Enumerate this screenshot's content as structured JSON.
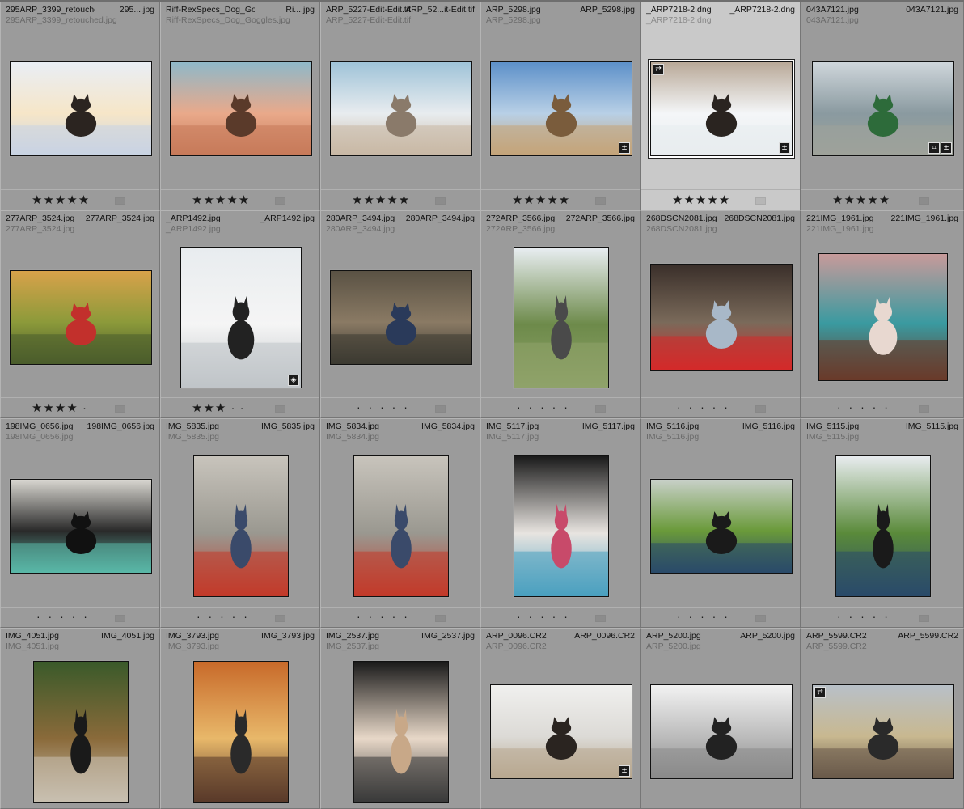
{
  "app": {
    "view": "Library Grid"
  },
  "rating_symbols": {
    "star": "★",
    "dot": "·"
  },
  "cells": [
    {
      "name_left": "295ARP_3399_retouched.jpg",
      "name_right": "295....jpg",
      "name_sub": "295ARP_3399_retouched.jpg",
      "rating": 5,
      "photo": "dog-snow-bokeh",
      "orientation": "landscape",
      "badges": []
    },
    {
      "name_left": "Riff-RexSpecs_Dog_Goggles.jpg",
      "name_right": "Ri....jpg",
      "name_sub": "Riff-RexSpecs_Dog_Goggles.jpg",
      "rating": 5,
      "photo": "dog-sunset-rock",
      "orientation": "landscape",
      "badges": []
    },
    {
      "name_left": "ARP_5227-Edit-Edit.tif",
      "name_right": "ARP_52...it-Edit.tif",
      "name_sub": "ARP_5227-Edit-Edit.tif",
      "rating": 5,
      "photo": "dog-desert",
      "orientation": "landscape",
      "badges": []
    },
    {
      "name_left": "ARP_5298.jpg",
      "name_right": "ARP_5298.jpg",
      "name_sub": "ARP_5298.jpg",
      "rating": 5,
      "photo": "woman-desert",
      "orientation": "landscape",
      "badges": [
        "develop-adjusted-icon"
      ]
    },
    {
      "name_left": "_ARP7218-2.dng",
      "name_right": "_ARP7218-2.dng",
      "name_sub": "_ARP7218-2.dng",
      "rating": 5,
      "photo": "dog-snow-run",
      "orientation": "landscape",
      "selected": true,
      "badges": [
        "sync-icon",
        "develop-adjusted-icon"
      ]
    },
    {
      "name_left": "043A7121.jpg",
      "name_right": "043A7121.jpg",
      "name_sub": "043A7121.jpg",
      "rating": 5,
      "photo": "couple-meadow",
      "orientation": "landscape",
      "badges": [
        "crop-icon",
        "develop-adjusted-icon"
      ]
    },
    {
      "name_left": "277ARP_3524.jpg",
      "name_right": "277ARP_3524.jpg",
      "name_sub": "277ARP_3524.jpg",
      "rating": 4,
      "photo": "dog-autumn",
      "orientation": "landscape",
      "badges": []
    },
    {
      "name_left": "_ARP1492.jpg",
      "name_right": "_ARP1492.jpg",
      "name_sub": "_ARP1492.jpg",
      "rating": 3,
      "photo": "chihuahua-portrait",
      "orientation": "portrait-wide",
      "badges": [
        "keyword-tag-icon"
      ]
    },
    {
      "name_left": "280ARP_3494.jpg",
      "name_right": "280ARP_3494.jpg",
      "name_sub": "280ARP_3494.jpg",
      "rating": 0,
      "photo": "man-dog-forest",
      "orientation": "landscape",
      "badges": []
    },
    {
      "name_left": "272ARP_3566.jpg",
      "name_right": "272ARP_3566.jpg",
      "name_sub": "272ARP_3566.jpg",
      "rating": 0,
      "photo": "person-lifting-dog",
      "orientation": "portrait",
      "badges": []
    },
    {
      "name_left": "268DSCN2081.jpg",
      "name_right": "268DSCN2081.jpg",
      "name_sub": "268DSCN2081.jpg",
      "rating": 0,
      "photo": "man-red-shirt",
      "orientation": "landscape-tall",
      "badges": []
    },
    {
      "name_left": "221IMG_1961.jpg",
      "name_right": "221IMG_1961.jpg",
      "name_sub": "221IMG_1961.jpg",
      "rating": 0,
      "photo": "dog-teal-chair",
      "orientation": "square",
      "badges": []
    },
    {
      "name_left": "198IMG_0656.jpg",
      "name_right": "198IMG_0656.jpg",
      "name_sub": "198IMG_0656.jpg",
      "rating": 0,
      "photo": "dog-blanket-tv",
      "orientation": "landscape",
      "badges": []
    },
    {
      "name_left": "IMG_5835.jpg",
      "name_right": "IMG_5835.jpg",
      "name_sub": "IMG_5835.jpg",
      "rating": 0,
      "photo": "woman-street-dog",
      "orientation": "portrait",
      "badges": []
    },
    {
      "name_left": "IMG_5834.jpg",
      "name_right": "IMG_5834.jpg",
      "name_sub": "IMG_5834.jpg",
      "rating": 0,
      "photo": "woman-street-dog-2",
      "orientation": "portrait",
      "badges": []
    },
    {
      "name_left": "IMG_5117.jpg",
      "name_right": "IMG_5117.jpg",
      "name_sub": "IMG_5117.jpg",
      "rating": 0,
      "photo": "dog-stroller",
      "orientation": "portrait",
      "badges": []
    },
    {
      "name_left": "IMG_5116.jpg",
      "name_right": "IMG_5116.jpg",
      "name_sub": "IMG_5116.jpg",
      "rating": 0,
      "photo": "dog-denim-park",
      "orientation": "landscape",
      "badges": []
    },
    {
      "name_left": "IMG_5115.jpg",
      "name_right": "IMG_5115.jpg",
      "name_sub": "IMG_5115.jpg",
      "rating": 0,
      "photo": "dog-denim-sunglasses",
      "orientation": "portrait",
      "badges": []
    },
    {
      "name_left": "IMG_4051.jpg",
      "name_right": "IMG_4051.jpg",
      "name_sub": "IMG_4051.jpg",
      "rating": null,
      "photo": "dog-camo-bag",
      "orientation": "portrait",
      "badges": []
    },
    {
      "name_left": "IMG_3793.jpg",
      "name_right": "IMG_3793.jpg",
      "name_sub": "IMG_3793.jpg",
      "rating": null,
      "photo": "dog-orange-door",
      "orientation": "portrait",
      "badges": []
    },
    {
      "name_left": "IMG_2537.jpg",
      "name_right": "IMG_2537.jpg",
      "name_sub": "IMG_2537.jpg",
      "rating": null,
      "photo": "dog-leather-jacket",
      "orientation": "portrait",
      "badges": []
    },
    {
      "name_left": "ARP_0096.CR2",
      "name_right": "ARP_0096.CR2",
      "name_sub": "ARP_0096.CR2",
      "rating": null,
      "photo": "dog-lying-bed",
      "orientation": "landscape",
      "badges": [
        "develop-adjusted-icon"
      ]
    },
    {
      "name_left": "ARP_5200.jpg",
      "name_right": "ARP_5200.jpg",
      "name_sub": "ARP_5200.jpg",
      "rating": null,
      "photo": "bw-beach-person",
      "orientation": "landscape",
      "badges": []
    },
    {
      "name_left": "ARP_5599.CR2",
      "name_right": "ARP_5599.CR2",
      "name_sub": "ARP_5599.CR2",
      "rating": null,
      "photo": "dog-hay-wagon",
      "orientation": "landscape",
      "badges": [
        "sync-icon"
      ]
    }
  ],
  "palette": {
    "dog-snow-bokeh": [
      "#e9eef5",
      "#f6e6c8",
      "#c9d3e3",
      "#2b2420"
    ],
    "dog-sunset-rock": [
      "#8fb8c9",
      "#e9a98a",
      "#c77a5a",
      "#5a3a2a"
    ],
    "dog-desert": [
      "#9fc3d8",
      "#e8ecef",
      "#c9b8a4",
      "#8a7a6a"
    ],
    "woman-desert": [
      "#5d90c9",
      "#b8d0e6",
      "#c5a479",
      "#7a5c3c"
    ],
    "dog-snow-run": [
      "#b9a998",
      "#f4f6f8",
      "#e8ecef",
      "#2a2420"
    ],
    "couple-meadow": [
      "#cfd6db",
      "#8a9aa0",
      "#9ea29a",
      "#2d6b3a"
    ],
    "dog-autumn": [
      "#d8a24a",
      "#8c9a3a",
      "#4b5d2c",
      "#c2302c"
    ],
    "chihuahua-portrait": [
      "#e8ecef",
      "#f5f5f5",
      "#c0c4c8",
      "#222"
    ],
    "man-dog-forest": [
      "#5a5244",
      "#8a7a64",
      "#3c3a32",
      "#2a3a5a"
    ],
    "person-lifting-dog": [
      "#e9eef2",
      "#6d8a4a",
      "#8fa36a",
      "#4a4a4a"
    ],
    "man-red-shirt": [
      "#3a2f2a",
      "#7a6a5a",
      "#d42a2a",
      "#a8b8c8"
    ],
    "dog-teal-chair": [
      "#c89a9a",
      "#3a9aa0",
      "#6a3a2a",
      "#e8d8d0"
    ],
    "dog-blanket-tv": [
      "#d8d6d0",
      "#2a2a2a",
      "#5ab8a8",
      "#111"
    ],
    "woman-street-dog": [
      "#c8c4bc",
      "#9a9890",
      "#c23a2a",
      "#3a4a6a"
    ],
    "woman-street-dog-2": [
      "#c8c4bc",
      "#9a9890",
      "#c23a2a",
      "#3a4a6a"
    ],
    "dog-stroller": [
      "#1a1a1a",
      "#e8e4e0",
      "#4aa0c0",
      "#c84a6a"
    ],
    "dog-denim-park": [
      "#c8d0c8",
      "#6a9a3a",
      "#2a4a6a",
      "#1a1a1a"
    ],
    "dog-denim-sunglasses": [
      "#e8ecef",
      "#5a8a3a",
      "#2a4a6a",
      "#1a1a1a"
    ],
    "dog-camo-bag": [
      "#3a5a2a",
      "#8a6a3a",
      "#c8c0b0",
      "#1a1a1a"
    ],
    "dog-orange-door": [
      "#c86a2a",
      "#e8b86a",
      "#5a3a2a",
      "#2a2a2a"
    ],
    "dog-leather-jacket": [
      "#1a1a1a",
      "#e8d8c8",
      "#3a3a3a",
      "#c8a888"
    ],
    "dog-lying-bed": [
      "#f0f0ee",
      "#dcdad6",
      "#b8a890",
      "#2a2420"
    ],
    "bw-beach-person": [
      "#f2f2f2",
      "#bcbcbc",
      "#8a8a8a",
      "#222"
    ],
    "dog-hay-wagon": [
      "#b8c0c8",
      "#c8b890",
      "#6a5a4a",
      "#2a2a2a"
    ]
  }
}
